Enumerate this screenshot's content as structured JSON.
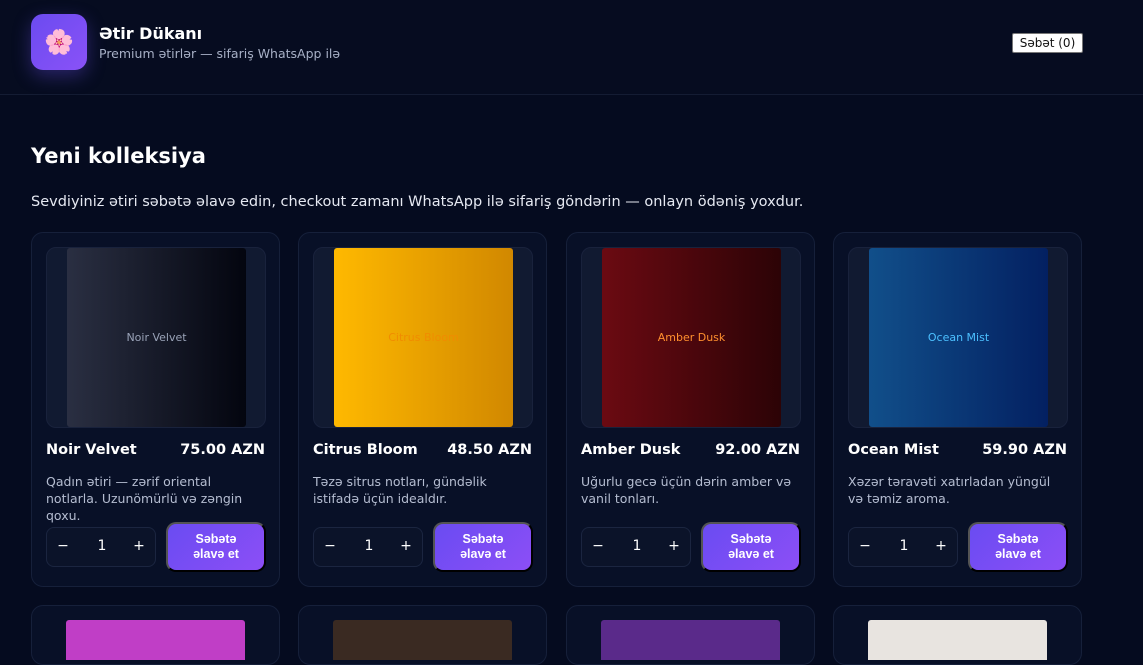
{
  "header": {
    "logo_icon": "cherry-blossom-icon",
    "logo_glyph": "🌸",
    "title": "Ətir Dükanı",
    "subtitle": "Premium ətirlər — sifariş WhatsApp ilə",
    "cart_label": "Səbət (0)"
  },
  "main": {
    "title": "Yeni kolleksiya",
    "lead": "Sevdiyiniz ətiri səbətə əlavə edin, checkout zamanı WhatsApp ilə sifariş göndərin — onlayn ödəniş yoxdur."
  },
  "products": [
    {
      "name": "Noir Velvet",
      "price": "75.00 AZN",
      "desc": "Qadın ətiri — zərif oriental notlarla. Uzunömürlü və zəngin qoxu.",
      "image_text": "Noir Velvet",
      "qty": "1",
      "minus": "−",
      "plus": "+",
      "add_label": "Səbətə əlavə et",
      "colors": [
        "#2a2f42",
        "#03050f"
      ],
      "text_color": "#9aa3b8"
    },
    {
      "name": "Citrus Bloom",
      "price": "48.50 AZN",
      "desc": "Təzə sitrus notları, gündəlik istifadə üçün idealdır.",
      "image_text": "Citrus Bloom",
      "qty": "1",
      "minus": "−",
      "plus": "+",
      "add_label": "Səbətə əlavə et",
      "colors": [
        "#ffb900",
        "#d18800"
      ],
      "text_color": "#f08c00"
    },
    {
      "name": "Amber Dusk",
      "price": "92.00 AZN",
      "desc": "Uğurlu gecə üçün dərin amber və vanil tonları.",
      "image_text": "Amber Dusk",
      "qty": "1",
      "minus": "−",
      "plus": "+",
      "add_label": "Səbətə əlavə et",
      "colors": [
        "#6b0a12",
        "#2c0306"
      ],
      "text_color": "#ff8f2e"
    },
    {
      "name": "Ocean Mist",
      "price": "59.90 AZN",
      "desc": "Xəzər təravəti xatırladan yüngül və təmiz aroma.",
      "image_text": "Ocean Mist",
      "qty": "1",
      "minus": "−",
      "plus": "+",
      "add_label": "Səbətə əlavə et",
      "colors": [
        "#114f8a",
        "#032061"
      ],
      "text_color": "#4cc0ff"
    }
  ],
  "next_row_colors": [
    "#c03ec6",
    "#3a2a22",
    "#5a2a8a",
    "#e8e4e0"
  ]
}
